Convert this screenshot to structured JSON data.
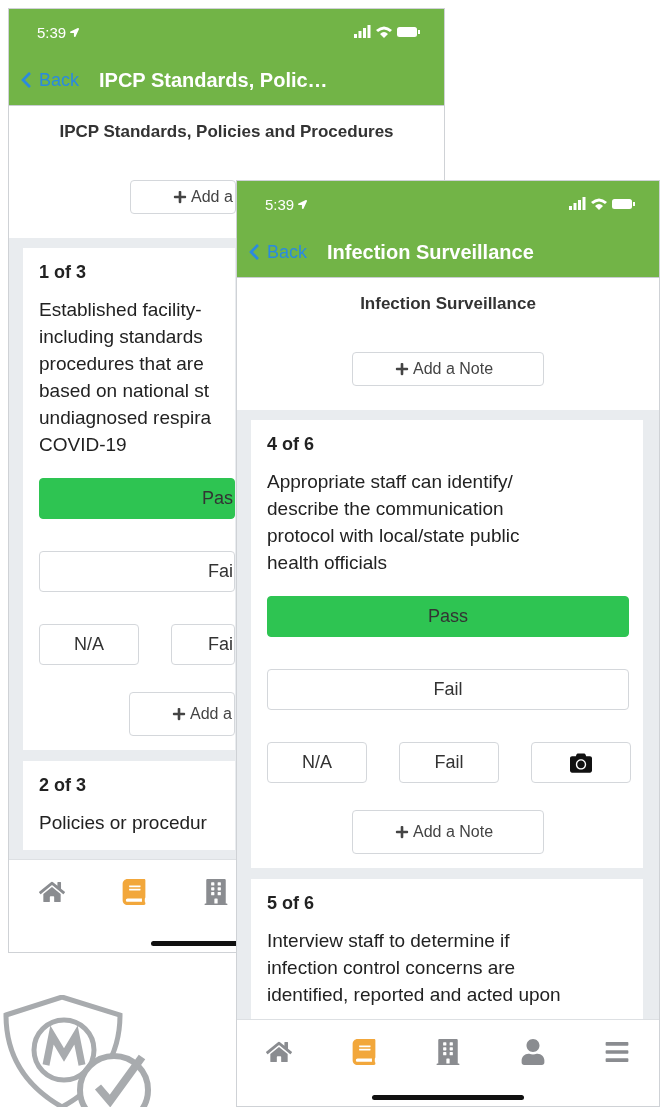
{
  "phones": [
    {
      "status_time": "5:39",
      "back_label": "Back",
      "nav_title": "IPCP Standards, Polic…",
      "section_title": "IPCP Standards, Policies and Procedures",
      "note_button": "Add a",
      "cards": [
        {
          "counter": "1 of 3",
          "question": "Established facility-\nincluding standards\nprocedures that are\nbased on national st\nundiagnosed respira\nCOVID-19",
          "options": [
            {
              "label": "Pas",
              "selected": true
            },
            {
              "label": "Fai",
              "selected": false
            }
          ],
          "actions": [
            {
              "kind": "text",
              "label": "N/A"
            },
            {
              "kind": "text",
              "label": "Fai"
            }
          ],
          "note_button": "Add a"
        },
        {
          "counter": "2 of 3",
          "question": "Policies or procedur"
        }
      ],
      "tabs": [
        {
          "selected": false
        },
        {
          "selected": true
        },
        {
          "selected": false
        }
      ]
    },
    {
      "status_time": "5:39",
      "back_label": "Back",
      "nav_title": "Infection Surveillance",
      "section_title": "Infection Surveillance",
      "note_button": "Add a Note",
      "cards": [
        {
          "counter": "4 of 6",
          "question": "Appropriate staff can identify/\ndescribe the communication\nprotocol with local/state public\nhealth officials",
          "options": [
            {
              "label": "Pass",
              "selected": true
            },
            {
              "label": "Fail",
              "selected": false
            }
          ],
          "actions": [
            {
              "kind": "text",
              "label": "N/A"
            },
            {
              "kind": "text",
              "label": "Fail"
            },
            {
              "kind": "camera"
            }
          ],
          "note_button": "Add a Note"
        },
        {
          "counter": "5 of 6",
          "question": "Interview staff to determine if\ninfection control concerns are\nidentified, reported and acted upon"
        }
      ],
      "tabs": [
        {
          "selected": false
        },
        {
          "selected": true
        },
        {
          "selected": false
        },
        {
          "selected": false
        },
        {
          "selected": false
        }
      ]
    }
  ]
}
